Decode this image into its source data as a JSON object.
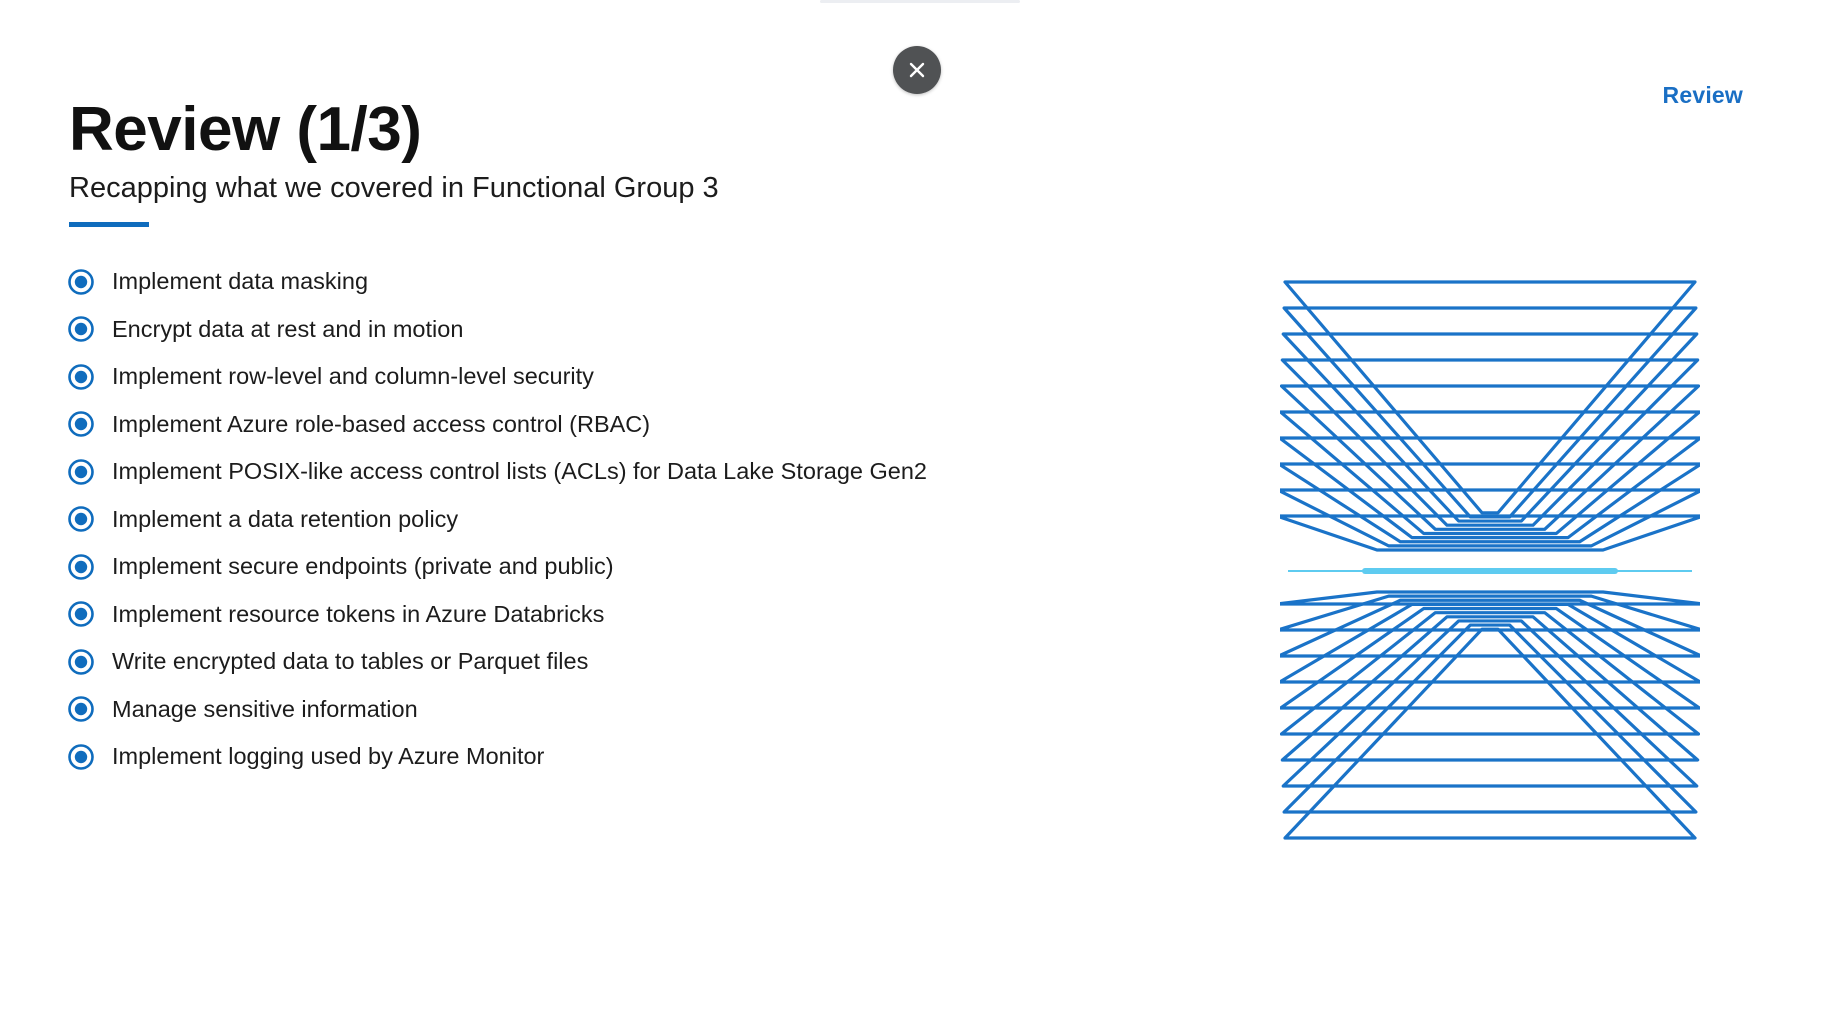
{
  "header": {
    "section_label": "Review",
    "title": "Review (1/3)",
    "subtitle": "Recapping what we covered in Functional Group 3"
  },
  "controls": {
    "close_icon": "close-icon"
  },
  "topics": [
    "Implement data masking",
    "Encrypt data at rest and in motion",
    "Implement row-level and column-level security",
    "Implement Azure role-based access control (RBAC)",
    "Implement POSIX-like access control lists (ACLs) for Data Lake Storage Gen2",
    "Implement a data retention policy",
    "Implement secure endpoints (private and public)",
    "Implement resource tokens in Azure Databricks",
    "Write encrypted data to tables or Parquet files",
    "Manage sensitive information",
    "Implement logging used by Azure Monitor"
  ],
  "icons": {
    "bullet": "radio-bullet-icon",
    "illustration": "layered-frames-illustration"
  },
  "colors": {
    "accent": "#0f6cbd",
    "link": "#1a6fc4",
    "close_bg": "#505254",
    "illustration_line": "#1a73c8",
    "illustration_glow": "#5ecbf0"
  }
}
